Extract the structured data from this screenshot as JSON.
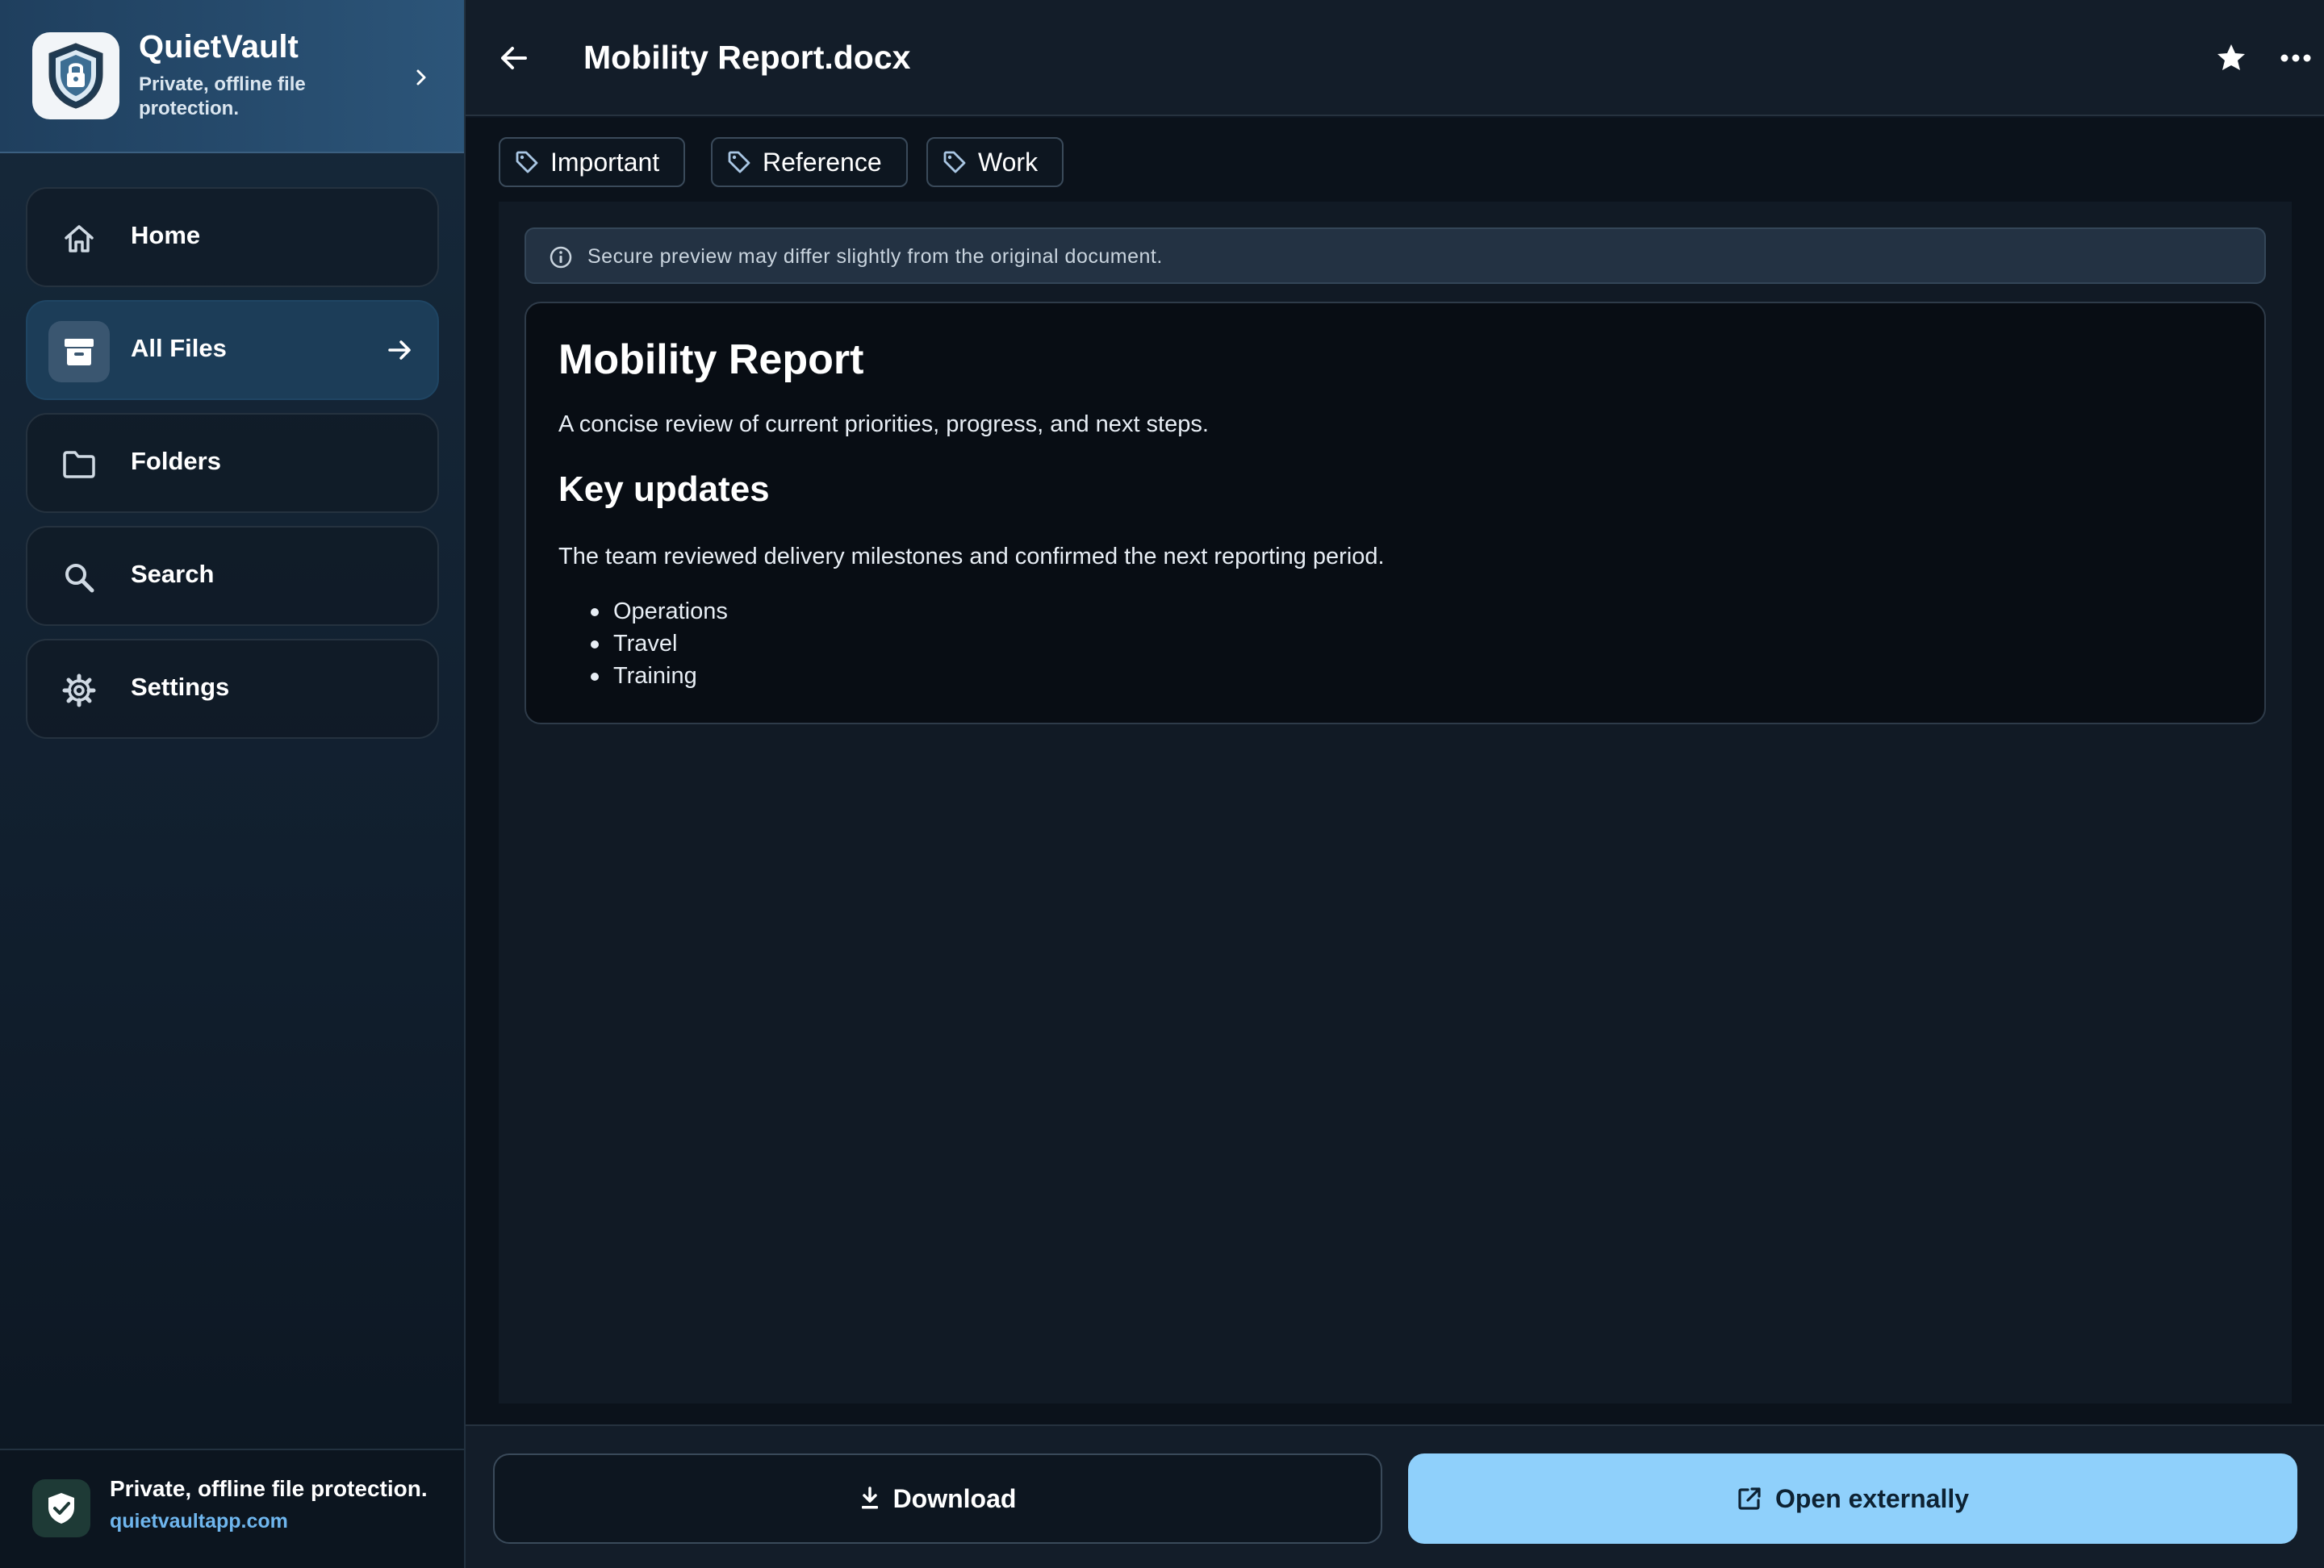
{
  "app": {
    "name": "QuietVault",
    "tagline": "Private, offline file protection."
  },
  "sidebar": {
    "items": [
      {
        "label": "Home",
        "icon": "home-icon"
      },
      {
        "label": "All Files",
        "icon": "archive-icon",
        "active": true
      },
      {
        "label": "Folders",
        "icon": "folder-icon"
      },
      {
        "label": "Search",
        "icon": "search-icon"
      },
      {
        "label": "Settings",
        "icon": "gear-icon"
      }
    ],
    "footer": {
      "title": "Private, offline file protection.",
      "link": "quietvaultapp.com"
    }
  },
  "header": {
    "title": "Mobility Report.docx"
  },
  "tags": [
    "Important",
    "Reference",
    "Work"
  ],
  "preview": {
    "notice": "Secure preview may differ slightly from the original document.",
    "heading": "Mobility Report",
    "subtitle": "A concise review of current priorities, progress, and next steps.",
    "section_heading": "Key updates",
    "paragraph": "The team reviewed delivery milestones and confirmed the next reporting period.",
    "bullets": [
      "Operations",
      "Travel",
      "Training"
    ]
  },
  "actions": {
    "download": "Download",
    "open_externally": "Open externally"
  },
  "colors": {
    "accent": "#8fd0fb",
    "link": "#6fb6ee",
    "active_nav": "#1c3d58"
  }
}
